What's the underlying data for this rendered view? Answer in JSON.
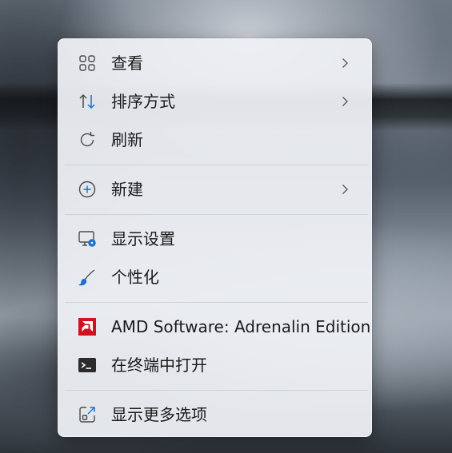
{
  "context_menu": {
    "items": [
      {
        "label": "查看",
        "icon": "grid-view-icon",
        "has_submenu": true
      },
      {
        "label": "排序方式",
        "icon": "sort-arrows-icon",
        "has_submenu": true
      },
      {
        "label": "刷新",
        "icon": "refresh-icon",
        "has_submenu": false
      },
      {
        "label": "新建",
        "icon": "new-plus-circle-icon",
        "has_submenu": true
      },
      {
        "label": "显示设置",
        "icon": "display-settings-icon",
        "has_submenu": false
      },
      {
        "label": "个性化",
        "icon": "brush-icon",
        "has_submenu": false
      },
      {
        "label": "AMD Software: Adrenalin Edition",
        "icon": "amd-logo-icon",
        "has_submenu": false
      },
      {
        "label": "在终端中打开",
        "icon": "terminal-icon",
        "has_submenu": false
      },
      {
        "label": "显示更多选项",
        "icon": "show-more-options-icon",
        "has_submenu": false
      }
    ]
  },
  "colors": {
    "menu_background": "#eef0f4",
    "text": "#1b1b1b",
    "icon_gray": "#4a4a4a",
    "accent_blue": "#1a6fd1",
    "amd_red": "#d3101f",
    "separator": "#cfd2d7"
  }
}
